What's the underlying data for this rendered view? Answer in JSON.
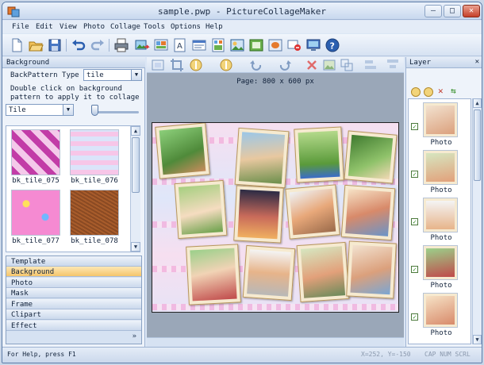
{
  "window": {
    "title": "sample.pwp - PictureCollageMaker",
    "minimize": "–",
    "maximize": "□",
    "close": "✕"
  },
  "menu": [
    "File",
    "Edit",
    "View",
    "Photo",
    "Collage",
    "Tools",
    "Options",
    "Help"
  ],
  "toolbar_icons": [
    "new-icon",
    "open-icon",
    "save-icon",
    "undo-icon",
    "redo-icon",
    "print-icon",
    "export-image-icon",
    "export-icon",
    "text-icon",
    "page-setup-icon",
    "template-icon",
    "clipart-icon",
    "frame-icon",
    "mask-icon",
    "settings-icon",
    "web-icon",
    "help-icon"
  ],
  "background_panel": {
    "caption": "Background",
    "pattern_type_label": "BackPattern Type",
    "pattern_type_value": "tile",
    "hint": "Double click on background pattern to apply it to collage",
    "mode_value": "Tile",
    "tiles": [
      "bk_tile_075",
      "bk_tile_076",
      "bk_tile_077",
      "bk_tile_078"
    ]
  },
  "accordion": [
    "Template",
    "Background",
    "Photo",
    "Mask",
    "Frame",
    "Clipart",
    "Effect"
  ],
  "accordion_active": "Background",
  "canvas": {
    "page_label": "Page: 800 x 600 px"
  },
  "layer_panel": {
    "caption": "Layer",
    "items": [
      "Photo",
      "Photo",
      "Photo",
      "Photo",
      "Photo"
    ]
  },
  "status": {
    "help": "For Help, press F1",
    "coords": "X=252, Y=-150",
    "keys": "CAP NUM SCRL"
  },
  "colors": {
    "accent": "#f5c56a",
    "frame": "#f6ead0",
    "bg_pattern": "#f3a9d9"
  }
}
